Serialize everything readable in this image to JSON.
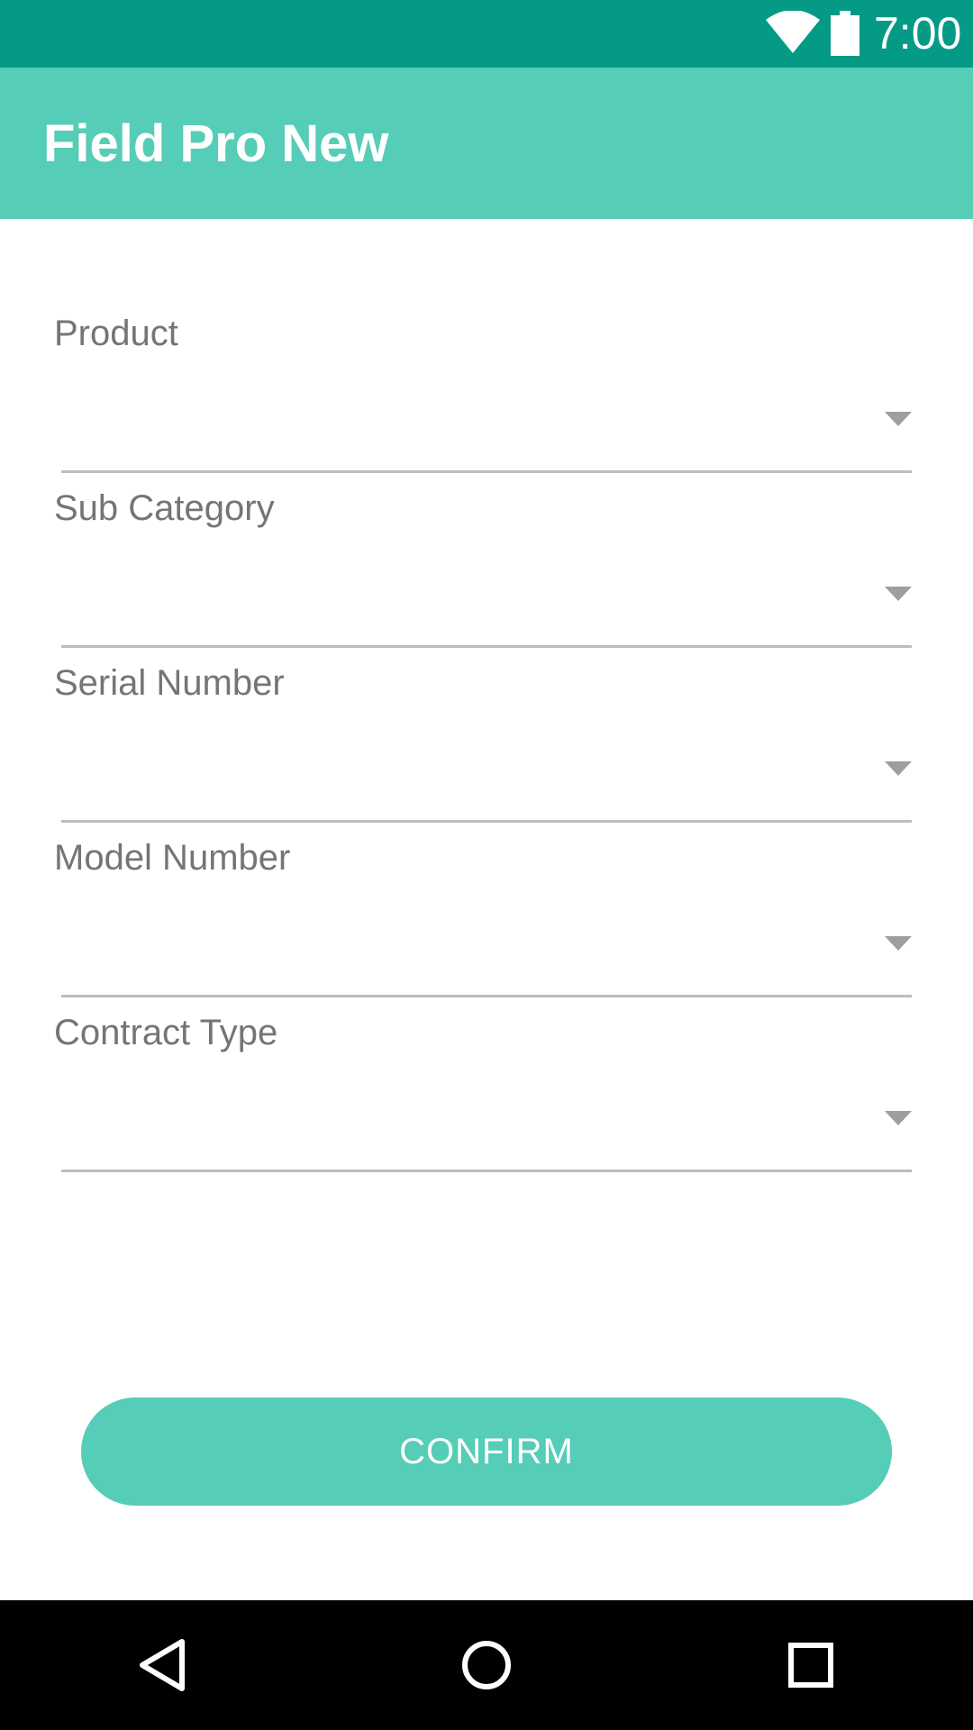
{
  "status_bar": {
    "time": "7:00",
    "icons": [
      "wifi-icon",
      "battery-icon"
    ],
    "background": "#059a86"
  },
  "app_bar": {
    "title": "Field Pro New",
    "background": "#56cdb6"
  },
  "form": {
    "fields": [
      {
        "label": "Product",
        "value": ""
      },
      {
        "label": "Sub Category",
        "value": ""
      },
      {
        "label": "Serial Number",
        "value": ""
      },
      {
        "label": "Model Number",
        "value": ""
      },
      {
        "label": "Contract Type",
        "value": ""
      }
    ]
  },
  "confirm_button": {
    "label": "CONFIRM",
    "background": "#56cdb6"
  },
  "nav_bar": {
    "buttons": [
      "back-icon",
      "home-icon",
      "recent-apps-icon"
    ]
  }
}
